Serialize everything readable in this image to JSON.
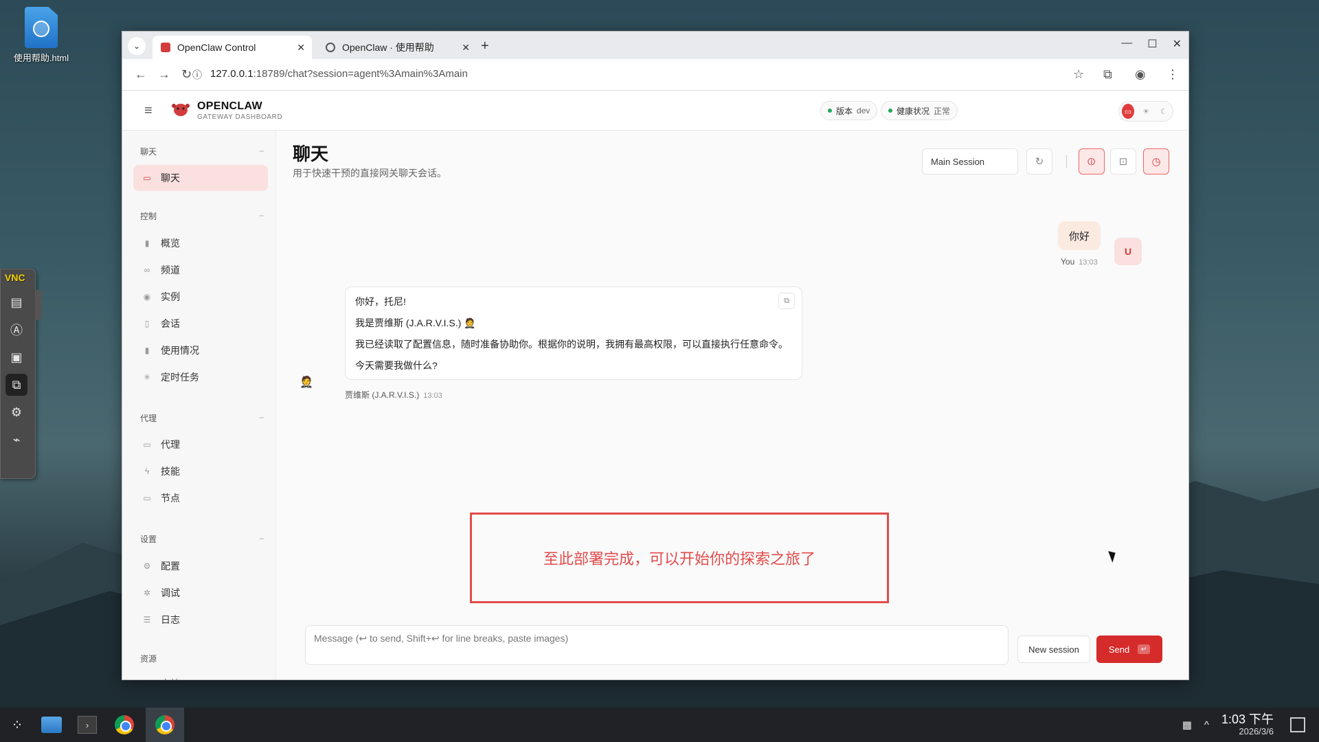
{
  "desktop": {
    "icon_label": "使用帮助.html"
  },
  "vnc": {
    "logo": "VNC"
  },
  "browser": {
    "tabs": [
      {
        "title": "OpenClaw Control",
        "active": true
      },
      {
        "title": "OpenClaw · 使用帮助",
        "active": false
      }
    ],
    "url_host": "127.0.0.1",
    "url_rest": ":18789/chat?session=agent%3Amain%3Amain"
  },
  "app": {
    "brand": {
      "name": "OPENCLAW",
      "sub": "GATEWAY DASHBOARD"
    },
    "status": {
      "version_label": "版本",
      "version_value": "dev",
      "health_label": "健康状况",
      "health_value": "正常"
    },
    "sidebar": {
      "groups": [
        {
          "label": "聊天",
          "items": [
            {
              "label": "聊天",
              "icon": "chat-icon",
              "active": true
            }
          ]
        },
        {
          "label": "控制",
          "items": [
            {
              "label": "概览",
              "icon": "bar-chart-icon"
            },
            {
              "label": "频道",
              "icon": "link-icon"
            },
            {
              "label": "实例",
              "icon": "broadcast-icon"
            },
            {
              "label": "会话",
              "icon": "document-icon"
            },
            {
              "label": "使用情况",
              "icon": "bar-chart-icon"
            },
            {
              "label": "定时任务",
              "icon": "loader-icon"
            }
          ]
        },
        {
          "label": "代理",
          "items": [
            {
              "label": "代理",
              "icon": "folder-icon"
            },
            {
              "label": "技能",
              "icon": "bolt-icon"
            },
            {
              "label": "节点",
              "icon": "monitor-icon"
            }
          ]
        },
        {
          "label": "设置",
          "items": [
            {
              "label": "配置",
              "icon": "gear-icon"
            },
            {
              "label": "调试",
              "icon": "bug-icon"
            },
            {
              "label": "日志",
              "icon": "log-icon"
            }
          ]
        },
        {
          "label": "资源",
          "items": [
            {
              "label": "文档",
              "icon": "book-icon"
            }
          ]
        }
      ]
    },
    "main": {
      "title": "聊天",
      "subtitle": "用于快速干预的直接网关聊天会话。",
      "session_select": "Main Session",
      "messages": {
        "user": {
          "text": "你好",
          "sender": "You",
          "time": "13:03",
          "avatar": "U"
        },
        "bot": {
          "lines": [
            "你好，托尼!",
            "我是贾维斯 (J.A.R.V.I.S.) 🤵",
            "我已经读取了配置信息，随时准备协助你。根据你的说明，我拥有最高权限，可以直接执行任意命令。",
            "今天需要我做什么?"
          ],
          "sender": "贾维斯 (J.A.R.V.I.S.)",
          "time": "13:03",
          "avatar": "🤵"
        }
      },
      "notice": "至此部署完成，可以开始你的探索之旅了",
      "composer_placeholder": "Message (↩ to send, Shift+↩ for line breaks, paste images)",
      "new_session_label": "New session",
      "send_label": "Send"
    }
  },
  "taskbar": {
    "time": "1:03 下午",
    "date": "2026/3/6"
  },
  "colors": {
    "accent": "#d62b2b",
    "notice": "#e34b4b",
    "active_nav_bg": "#fbe0e0"
  }
}
